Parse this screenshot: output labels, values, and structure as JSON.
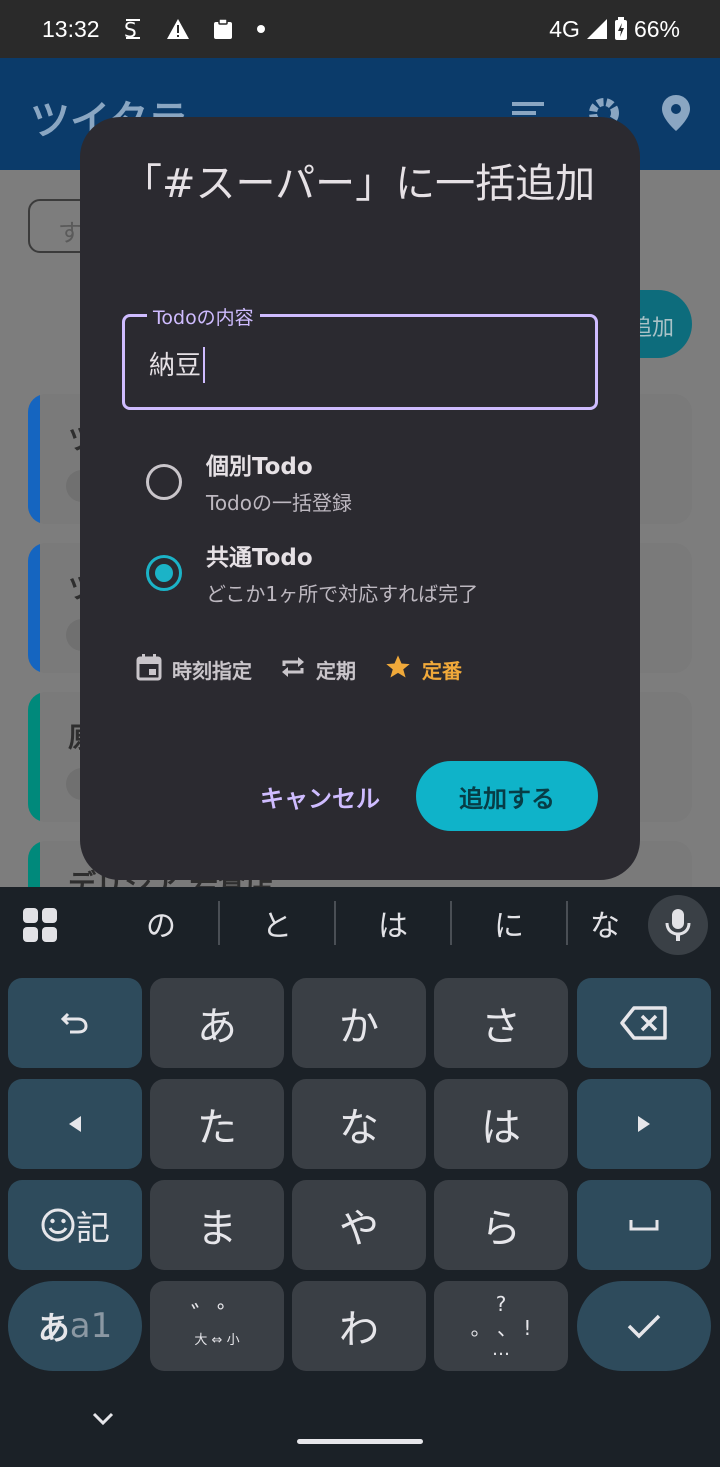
{
  "status_bar": {
    "time": "13:32",
    "network": "4G",
    "battery": "66%"
  },
  "app": {
    "title": "ツイタラ",
    "search_text": "す",
    "add_button_fragment": "追加",
    "cards": [
      {
        "title_fragment": "ツ",
        "stripe": "#1565c0"
      },
      {
        "title_fragment": "ツ",
        "stripe": "#1565c0"
      },
      {
        "title_fragment": "原",
        "stripe": "#00897b"
      },
      {
        "title_fragment": "デリシア 岩倉店",
        "stripe": "#00897b"
      }
    ]
  },
  "dialog": {
    "title": "「#スーパー」に一括追加",
    "field_label": "Todoの内容",
    "field_value": "納豆",
    "options": [
      {
        "title": "個別Todo",
        "subtitle": "Todoの一括登録",
        "selected": false
      },
      {
        "title": "共通Todo",
        "subtitle": "どこか1ヶ所で対応すれば完了",
        "selected": true
      }
    ],
    "chips": {
      "time": "時刻指定",
      "repeat": "定期",
      "favorite": "定番"
    },
    "cancel_label": "キャンセル",
    "submit_label": "追加する"
  },
  "keyboard": {
    "suggestions": [
      "の",
      "と",
      "は",
      "に",
      "な"
    ],
    "rows": [
      [
        "undo",
        "あ",
        "か",
        "さ",
        "backspace"
      ],
      [
        "left",
        "た",
        "な",
        "は",
        "right"
      ],
      [
        "emoji-記",
        "ま",
        "や",
        "ら",
        "space"
      ],
      [
        "あa1",
        "゛゜大⇔小",
        "わ",
        "、。?!",
        "enter"
      ]
    ],
    "kana_labels": {
      "a": "あ",
      "ka": "か",
      "sa": "さ",
      "ta": "た",
      "na": "な",
      "ha": "は",
      "ma": "ま",
      "ya": "や",
      "ra": "ら",
      "wa": "わ",
      "emoji_ki": "記",
      "mode_a": "あ",
      "mode_a1": "a1",
      "dakuten": "゛゜",
      "daisho": "大 ⇔ 小",
      "punct_q": "?",
      "punct_marks": "。 、 !",
      "punct_dots": "…"
    }
  },
  "colors": {
    "accent": "#cfbcff",
    "teal": "#0fb3c9",
    "star": "#f0a93a"
  }
}
